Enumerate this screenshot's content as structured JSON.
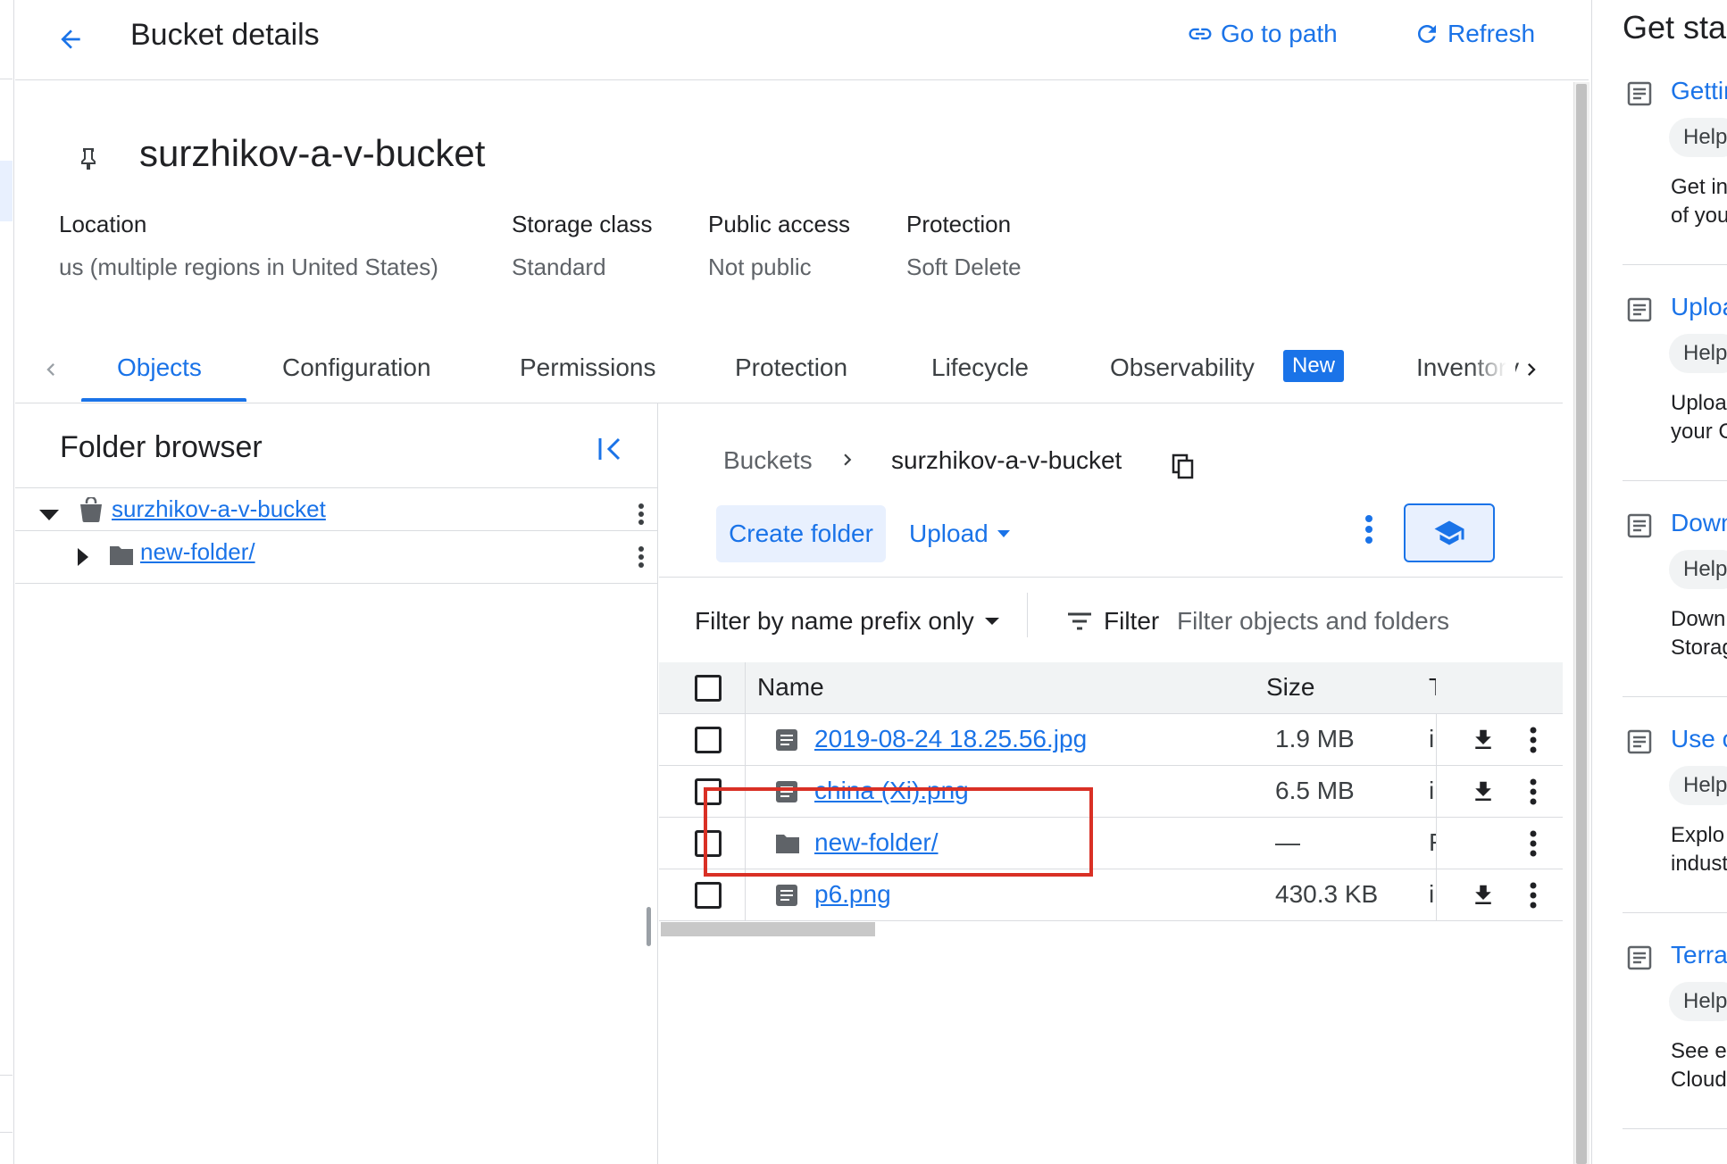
{
  "header": {
    "title": "Bucket details",
    "go_to_path": "Go to path",
    "refresh": "Refresh"
  },
  "bucket": {
    "name": "surzhikov-a-v-bucket",
    "info": [
      {
        "label": "Location",
        "value": "us (multiple regions in United States)"
      },
      {
        "label": "Storage class",
        "value": "Standard"
      },
      {
        "label": "Public access",
        "value": "Not public"
      },
      {
        "label": "Protection",
        "value": "Soft Delete"
      }
    ]
  },
  "tabs": [
    {
      "label": "Objects",
      "active": true
    },
    {
      "label": "Configuration"
    },
    {
      "label": "Permissions"
    },
    {
      "label": "Protection"
    },
    {
      "label": "Lifecycle"
    },
    {
      "label": "Observability",
      "badge": "New"
    },
    {
      "label": "Inventory"
    }
  ],
  "folder_browser": {
    "title": "Folder browser",
    "tree": [
      {
        "name": "surzhikov-a-v-bucket",
        "type": "bucket",
        "expanded": true
      },
      {
        "name": "new-folder/",
        "type": "folder",
        "expanded": false
      }
    ]
  },
  "objects": {
    "breadcrumb": {
      "root": "Buckets",
      "current": "surzhikov-a-v-bucket"
    },
    "create_folder": "Create folder",
    "upload": "Upload",
    "filter_mode": "Filter by name prefix only",
    "filter_label": "Filter",
    "filter_placeholder": "Filter objects and folders",
    "columns": {
      "name": "Name",
      "size": "Size",
      "type": "T"
    },
    "rows": [
      {
        "name": "2019-08-24 18.25.56.jpg",
        "size": "1.9 MB",
        "type": "i",
        "kind": "file",
        "download": true
      },
      {
        "name": "china (Xi).png",
        "size": "6.5 MB",
        "type": "i",
        "kind": "file",
        "download": true
      },
      {
        "name": "new-folder/",
        "size": "—",
        "type": "F",
        "kind": "folder",
        "download": false
      },
      {
        "name": "p6.png",
        "size": "430.3 KB",
        "type": "i",
        "kind": "file",
        "download": true
      }
    ]
  },
  "right_panel": {
    "title": "Get started",
    "items": [
      {
        "title": "Getting",
        "chip": "Help",
        "line1": "Get in",
        "line2": "of you"
      },
      {
        "title": "Upload",
        "chip": "Help",
        "line1": "Upload",
        "line2": "your C"
      },
      {
        "title": "Download",
        "chip": "Help",
        "line1": "Down",
        "line2": "Storag"
      },
      {
        "title": "Use c",
        "chip": "Help",
        "line1": "Explo",
        "line2": "indust"
      },
      {
        "title": "Terra",
        "chip": "Help",
        "line1": "See e",
        "line2": "Cloud"
      }
    ]
  },
  "colors": {
    "accent": "#1a73e8",
    "accent_bg": "#e8f0fe",
    "annotation": "#d93025"
  }
}
